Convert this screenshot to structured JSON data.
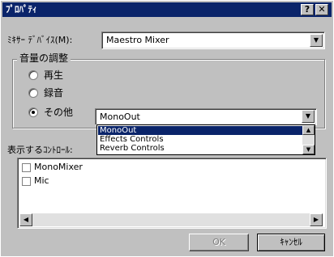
{
  "window": {
    "title": "ﾌﾟﾛﾊﾟﾃｨ",
    "help_glyph": "?",
    "close_glyph": "✕"
  },
  "mixer": {
    "label": "ﾐｷｻｰ ﾃﾞﾊﾞｲｽ(M):",
    "value": "Maestro Mixer"
  },
  "volume_group": {
    "title": "音量の調整",
    "options": [
      {
        "label": "再生",
        "selected": false
      },
      {
        "label": "録音",
        "selected": false
      },
      {
        "label": "その他",
        "selected": true
      }
    ],
    "other_combo_value": "MonoOut",
    "dropdown_items": [
      {
        "label": "MonoOut",
        "selected": true
      },
      {
        "label": "Effects Controls",
        "selected": false
      },
      {
        "label": "Reverb Controls",
        "selected": false
      }
    ]
  },
  "controls_label": "表示するｺﾝﾄﾛｰﾙ:",
  "controls_list": [
    {
      "label": "MonoMixer",
      "checked": false
    },
    {
      "label": "Mic",
      "checked": false
    }
  ],
  "buttons": {
    "ok": "OK",
    "cancel": "ｷｬﾝｾﾙ"
  },
  "colors": {
    "titlebar": "#0a246a",
    "face": "#c0c0c0",
    "selection": "#0a246a"
  }
}
